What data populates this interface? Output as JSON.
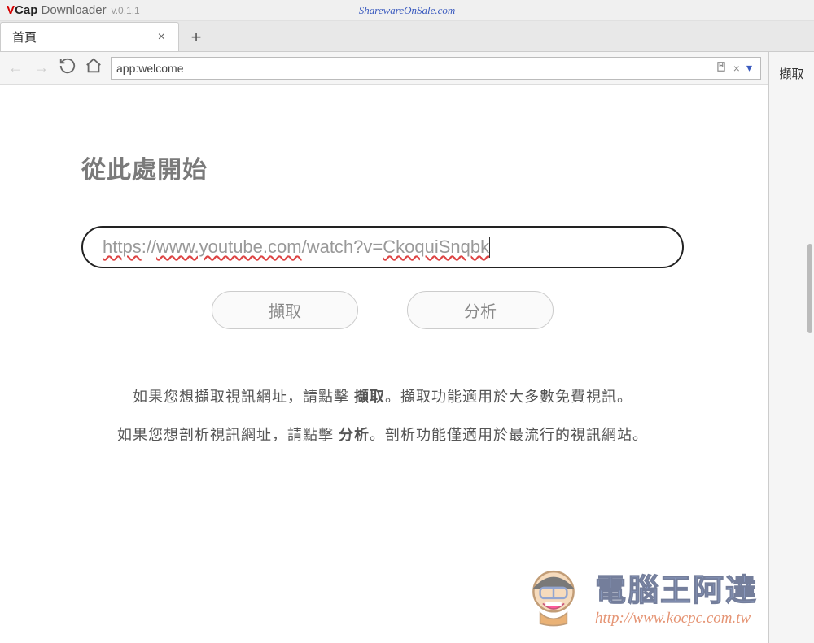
{
  "app": {
    "logo_v": "V",
    "logo_cap": "Cap",
    "logo_dl": "Downloader",
    "version": "v.0.1.1",
    "promo": "SharewareOnSale.com"
  },
  "tabs": [
    {
      "label": "首頁"
    }
  ],
  "address_bar": {
    "value": "app:welcome"
  },
  "sidebar": {
    "capture_label": "擷取"
  },
  "welcome": {
    "heading": "從此處開始",
    "url_input": "https://www.youtube.com/watch?v=CkoquiSnqbk",
    "capture_btn": "擷取",
    "analyze_btn": "分析",
    "line1_pre": "如果您想擷取視訊網址，請點擊 ",
    "line1_bold": "擷取",
    "line1_post": "。擷取功能適用於大多數免費視訊。",
    "line2_pre": "如果您想剖析視訊網址，請點擊 ",
    "line2_bold": "分析",
    "line2_post": "。剖析功能僅適用於最流行的視訊網站。"
  },
  "watermark": {
    "title": "電腦王阿達",
    "url": "http://www.kocpc.com.tw"
  }
}
